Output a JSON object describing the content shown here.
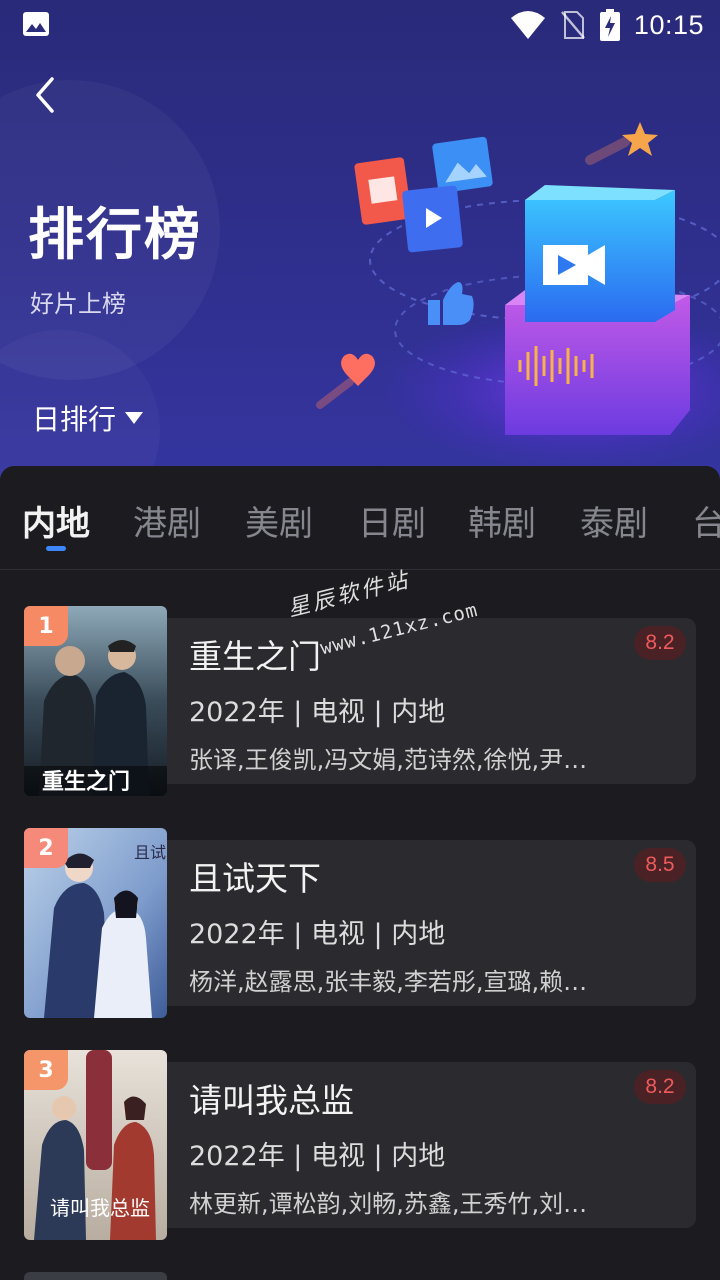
{
  "status_bar": {
    "time": "10:15",
    "icons": [
      "image-icon",
      "wifi-icon",
      "no-sim-icon",
      "battery-charging-icon"
    ]
  },
  "header": {
    "title": "排行榜",
    "subtitle": "好片上榜",
    "rank_period": "日排行"
  },
  "tabs": [
    {
      "label": "内地",
      "active": true
    },
    {
      "label": "港剧",
      "active": false
    },
    {
      "label": "美剧",
      "active": false
    },
    {
      "label": "日剧",
      "active": false
    },
    {
      "label": "韩剧",
      "active": false
    },
    {
      "label": "泰剧",
      "active": false
    },
    {
      "label": "台",
      "active": false
    }
  ],
  "items": [
    {
      "rank": "1",
      "title": "重生之门",
      "meta": "2022年 | 电视 | 内地",
      "cast": "张译,王俊凯,冯文娟,范诗然,徐悦,尹…",
      "score": "8.2",
      "poster_caption": "重生之门"
    },
    {
      "rank": "2",
      "title": "且试天下",
      "meta": "2022年 | 电视 | 内地",
      "cast": "杨洋,赵露思,张丰毅,李若彤,宣璐,赖…",
      "score": "8.5",
      "poster_caption": "且试"
    },
    {
      "rank": "3",
      "title": "请叫我总监",
      "meta": "2022年 | 电视 | 内地",
      "cast": "林更新,谭松韵,刘畅,苏鑫,王秀竹,刘…",
      "score": "8.2",
      "poster_caption": "请叫我总监"
    }
  ],
  "watermark": {
    "text": "星辰软件站",
    "url": "www.121xz.com"
  },
  "colors": {
    "accent": "#3e86f7",
    "score_text": "#ef5a5a",
    "rank_1": "#f58a65",
    "rank_2": "#f58a7a",
    "rank_3": "#f5956a"
  }
}
